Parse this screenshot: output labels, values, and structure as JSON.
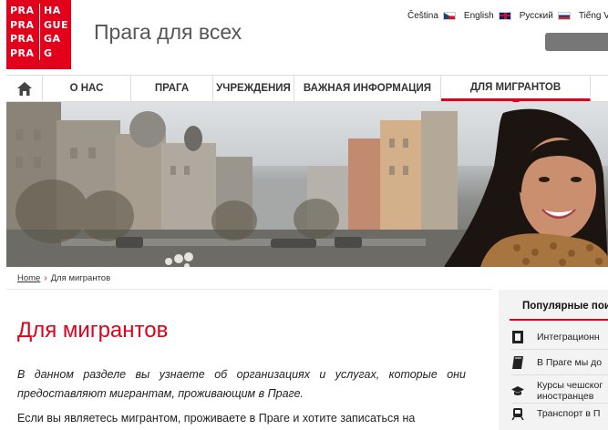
{
  "logo": {
    "rows": [
      [
        "PRA",
        "HA"
      ],
      [
        "PRA",
        "GUE"
      ],
      [
        "PRA",
        "GA"
      ],
      [
        "PRA",
        "G"
      ]
    ]
  },
  "header": {
    "site_title": "Прага для всех"
  },
  "languages": [
    {
      "label": "Čeština",
      "flag": "cz-flag"
    },
    {
      "label": "English",
      "flag": "gb-flag"
    },
    {
      "label": "Русский",
      "flag": "ru-flag"
    },
    {
      "label": "Tiếng Việ",
      "flag": ""
    }
  ],
  "nav": {
    "home_icon": "home-icon",
    "items": [
      "О НАС",
      "ПРАГА",
      "УЧРЕЖДЕНИЯ",
      "ВАЖНАЯ ИНФОРМАЦИЯ",
      "ДЛЯ МИГРАНТОВ"
    ],
    "active_index": 4
  },
  "breadcrumb": {
    "home": "Home",
    "current": "Для мигрантов"
  },
  "main": {
    "title": "Для мигрантов",
    "intro_line1": "В данном разделе вы узнаете об организациях и услугах, которые они",
    "intro_line2": "предоставляют мигрантам, проживающим в Праге.",
    "para_line1": "Если вы являетесь мигрантом, проживаете в Праге и хотите записаться на"
  },
  "sidebar": {
    "heading": "Популярные поис",
    "items": [
      {
        "icon": "document-icon",
        "line1": "Интеграционн",
        "line2": ""
      },
      {
        "icon": "book-icon",
        "line1": "В Праге мы до",
        "line2": ""
      },
      {
        "icon": "graduation-cap-icon",
        "line1": "Курсы чешског",
        "line2": "иностранцев"
      },
      {
        "icon": "tram-icon",
        "line1": "Транспорт в П",
        "line2": ""
      }
    ]
  },
  "colors": {
    "accent": "#e2001a",
    "text": "#333333",
    "sidebar_bg": "#f3f3f3"
  }
}
